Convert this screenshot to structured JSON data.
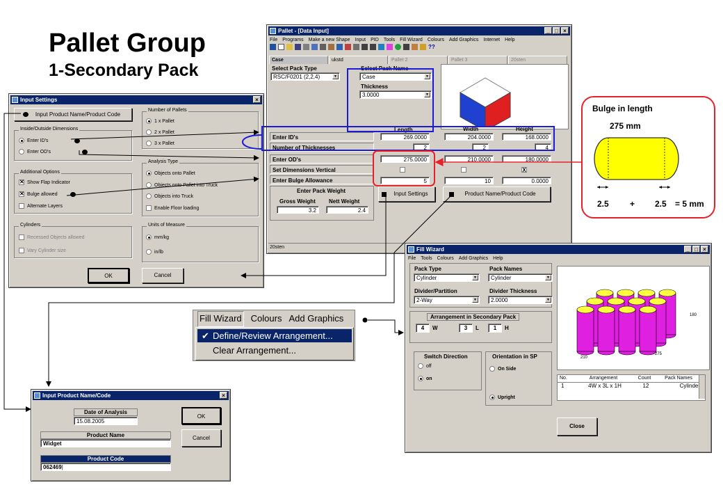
{
  "slide": {
    "title": "Pallet Group",
    "subtitle": "1-Secondary Pack"
  },
  "pallet_window": {
    "title": "Pallet - [Data Input]",
    "menu": [
      "File",
      "Programs",
      "Make a new Shape",
      "Input",
      "PID",
      "Tools",
      "Fill Wizard",
      "Colours",
      "Add Graphics",
      "Internet",
      "Help"
    ],
    "tabs": [
      "Case",
      "ukstd",
      "Pallet 2",
      "Pallet 3",
      "20sten"
    ],
    "select_pack_type_label": "Select Pack Type",
    "select_pack_type_value": "RSC/F0201 (2,2,4)",
    "select_pack_name_label": "Select Pack Name",
    "select_pack_name_value": "Case",
    "thickness_label": "Thickness",
    "thickness_value": "3.0000",
    "col_length": "Length",
    "col_width": "Width",
    "col_height": "Height",
    "rows": {
      "ids": {
        "label": "Enter ID's",
        "length": "269.0000",
        "width": "204.0000",
        "height": "168.0000"
      },
      "thick": {
        "label": "Number of Thicknesses",
        "length": "2",
        "width": "2",
        "height": "4"
      },
      "ods": {
        "label": "Enter OD's",
        "length": "275.0000",
        "width": "210.0000",
        "height": "180.0000"
      },
      "vertical": {
        "label": "Set Dimensions Vertical",
        "height_mark": "X"
      },
      "bulge": {
        "label": "Enter Bulge Allowance",
        "length": "5",
        "width": "10",
        "height": "0.0000"
      }
    },
    "pack_weight_title": "Enter Pack Weight",
    "gross_weight_label": "Gross Weight",
    "gross_weight_value": "3.2",
    "nett_weight_label": "Nett Weight",
    "nett_weight_value": "2.4",
    "input_settings_button": "Input Settings",
    "product_name_button": "Product Name/Product Code",
    "status": "20sten"
  },
  "input_settings": {
    "title": "Input Settings",
    "product_button": "Input Product Name/Product Code",
    "inside_outside_group": "Inside/Outside Dimensions",
    "enter_ids": "Enter ID's",
    "enter_ods": "Enter OD's",
    "additional_group": "Additional Options",
    "show_flap": "Show Flap Indicator",
    "bulge_allowed": "Bulge allowed",
    "alternate_layers": "Alternate Layers",
    "cylinders_group": "Cylinders",
    "recessed": "Recessed Objects allowed",
    "vary_cylinder": "Vary Cylinder size",
    "pallets_group": "Number of Pallets",
    "pallet_1": "1 x Pallet",
    "pallet_2": "2 x Pallet",
    "pallet_3": "3 x Pallet",
    "analysis_group": "Analysis Type",
    "objects_pallet": "Objects onto Pallet",
    "objects_pallet_truck": "Objects onto Pallet into Truck",
    "objects_truck": "Objects into Truck",
    "floor_loading": "Enable Floor loading",
    "units_group": "Units of Measure",
    "mm_kg": "mm/kg",
    "in_lb": "in/lb",
    "ok": "OK",
    "cancel": "Cancel"
  },
  "bulge_callout": {
    "title": "Bulge in length",
    "length": "275 mm",
    "left": "2.5",
    "plus": "+",
    "right": "2.5",
    "total": "= 5 mm"
  },
  "fill_menu": {
    "items": [
      "Fill Wizard",
      "Colours",
      "Add Graphics"
    ],
    "define": "Define/Review Arrangement...",
    "clear": "Clear Arrangement..."
  },
  "fill_wizard": {
    "title": "Fill Wizard",
    "menu": [
      "File",
      "Tools",
      "Colours",
      "Add Graphics",
      "Help"
    ],
    "pack_type_label": "Pack Type",
    "pack_type_value": "Cylinder",
    "pack_names_label": "Pack Names",
    "pack_names_value": "Cylinder",
    "divider_label": "Divider/Partition",
    "divider_value": "2-Way",
    "divider_thickness_label": "Divider Thickness",
    "divider_thickness_value": "2.0000",
    "arrangement_title": "Arrangement in Secondary Pack",
    "w_value": "4",
    "w_label": "W",
    "l_value": "3",
    "l_label": "L",
    "h_value": "1",
    "h_label": "H",
    "switch_group": "Switch Direction",
    "off": "off",
    "on": "on",
    "orientation_group": "Orientation in SP",
    "on_side": "On Side",
    "upright": "Upright",
    "dims": {
      "height": "180",
      "depth": "210",
      "width": "275"
    },
    "table_headers": [
      "No.",
      "Arrangement",
      "Count",
      "Pack Names"
    ],
    "table_row": [
      "1",
      "4W x 3L x 1H",
      "12",
      "Cylinder"
    ],
    "close": "Close"
  },
  "product_dialog": {
    "title": "Input Product Name/Code",
    "date_label": "Date of Analysis",
    "date_value": "15.08.2005",
    "name_label": "Product Name",
    "name_value": "Widget",
    "code_label": "Product Code",
    "code_value": "062469",
    "ok": "OK",
    "cancel": "Cancel"
  },
  "colors": {
    "titlebar": "#0a246a",
    "red_callout": "#e8202a",
    "blue_highlight": "#1a1ad8",
    "cylinder": "#e020e0",
    "cylinder_top": "#ffff40"
  }
}
